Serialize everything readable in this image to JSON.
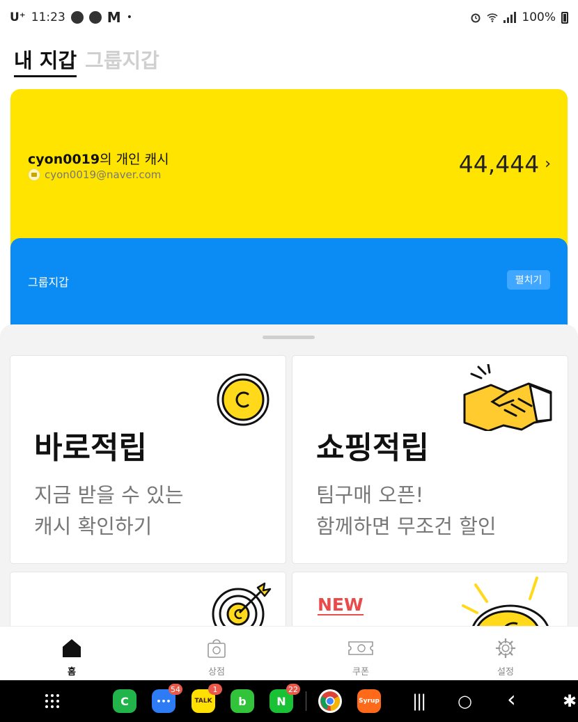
{
  "status_bar": {
    "carrier": "U⁺",
    "time": "11:23",
    "notif_icons": [
      "fan-icon",
      "lock-icon"
    ],
    "notif_m": "M",
    "notif_dot": "•",
    "battery": "100%"
  },
  "tabs": {
    "my_wallet": "내 지갑",
    "group_wallet": "그룹지갑"
  },
  "personal_card": {
    "user": "cyon0019",
    "suffix": "의 개인 캐시",
    "email": "cyon0019@naver.com",
    "balance": "44,444",
    "chevron": "›",
    "color": "#ffe400"
  },
  "group_card": {
    "title": "그룹지갑",
    "expand_label": "펼치기",
    "color": "#0b8cf5"
  },
  "feature_cards": [
    {
      "title": "바로적립",
      "desc_line1": "지금 받을 수 있는",
      "desc_line2": "캐시 확인하기",
      "icon": "coin-icon"
    },
    {
      "title": "쇼핑적립",
      "desc_line1": "팀구매 오픈!",
      "desc_line2": "함께하면 무조건 할인",
      "icon": "handshake-icon"
    },
    {
      "icon": "target-icon"
    },
    {
      "badge": "NEW",
      "icon": "coin-burst-icon"
    }
  ],
  "bottom_nav": [
    {
      "label": "홈",
      "icon": "home-icon",
      "active": true
    },
    {
      "label": "상점",
      "icon": "shopping-bag-icon"
    },
    {
      "label": "쿠폰",
      "icon": "coupon-icon"
    },
    {
      "label": "설정",
      "icon": "gear-icon"
    }
  ],
  "system_nav": {
    "apps": [
      {
        "name": "phone-app-icon",
        "glyph": "C",
        "color": "#20b44b"
      },
      {
        "name": "messages-app-icon",
        "glyph": "•••",
        "color": "#2e7bf6",
        "badge": "54"
      },
      {
        "name": "kakaotalk-app-icon",
        "glyph": "TALK",
        "color": "#ffe000",
        "badge": "1"
      },
      {
        "name": "band-app-icon",
        "glyph": "b",
        "color": "#31c43a"
      },
      {
        "name": "naver-app-icon",
        "glyph": "N",
        "color": "#19c234",
        "badge": "22"
      },
      {
        "name": "chrome-app-icon",
        "glyph": "",
        "color": "#ffffff"
      },
      {
        "name": "syrup-app-icon",
        "glyph": "Syrup",
        "color": "#ff6a1a"
      }
    ],
    "recents": "|||",
    "home": "○",
    "back": "‹",
    "accessibility": "✱"
  },
  "colors": {
    "accent_yellow": "#ffe400",
    "accent_blue": "#0b8cf5",
    "new_red": "#e94b4b"
  }
}
